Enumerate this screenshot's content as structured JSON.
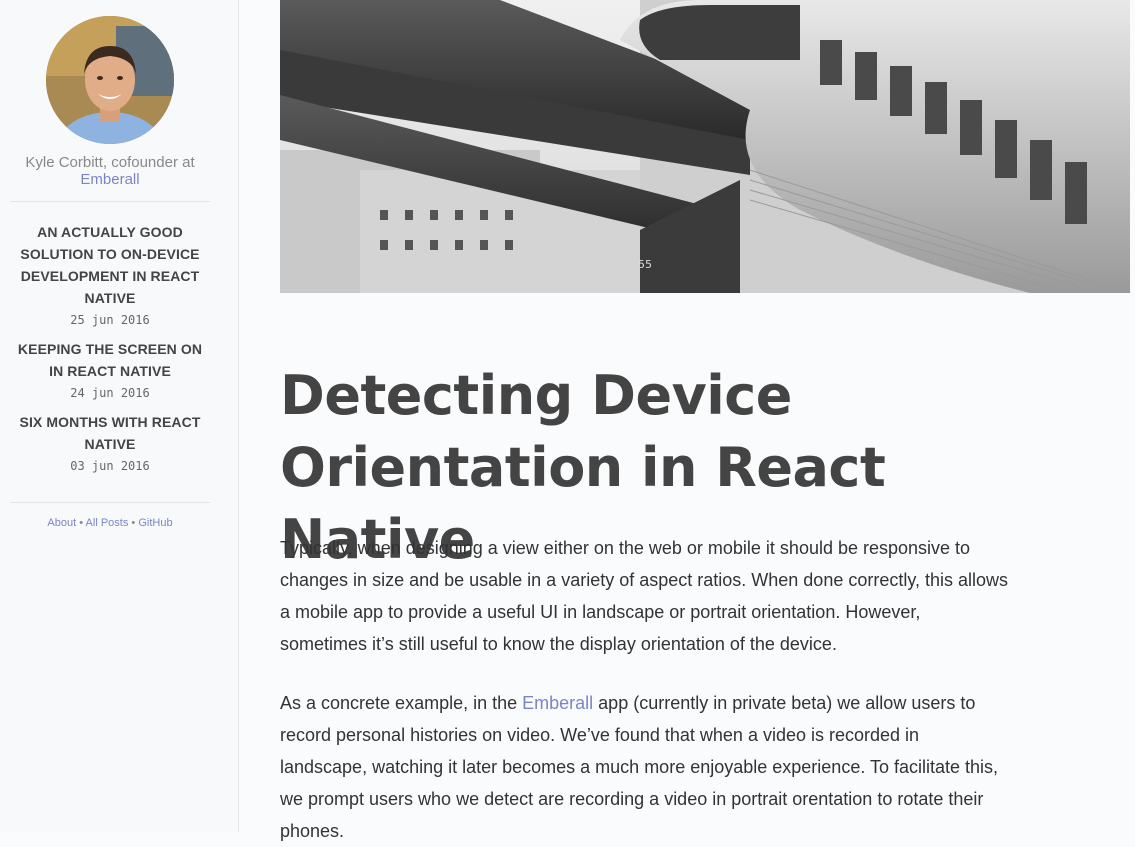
{
  "sidebar": {
    "byline_text": "Kyle Corbitt, cofounder at",
    "byline_link": "Emberall",
    "posts": [
      {
        "title": "An actually good solution to on-device development in React Native",
        "date": "25 jun 2016"
      },
      {
        "title": "Keeping the screen on in React Native",
        "date": "24 jun 2016"
      },
      {
        "title": "Six months with React Native",
        "date": "03 jun 2016"
      }
    ],
    "links": {
      "about": "About",
      "all_posts": "All Posts",
      "github": "GitHub",
      "separator": "•"
    }
  },
  "article": {
    "hero_label": "55",
    "title": "Detecting Device Orientation in React Native",
    "p1": "Typically, when designing a view either on the web or mobile it should be responsive to changes in size and be usable in a variety of aspect ratios. When done correctly, this allows a mobile app to provide a useful UI in landscape or portrait orientation. However, sometimes it’s still useful to know the display orientation of the device.",
    "p2_before": "As a concrete example, in the ",
    "p2_link": "Emberall",
    "p2_after": " app (currently in private beta) we allow users to record personal histories on video. We’ve found that when a video is recorded in landscape, watching it later becomes a much more enjoyable experience. To facilitate this, we prompt users who we detect are recording a video in portrait orentation to rotate their phones."
  },
  "colors": {
    "link": "#7b85c6",
    "title": "#444444",
    "text": "#333333"
  }
}
